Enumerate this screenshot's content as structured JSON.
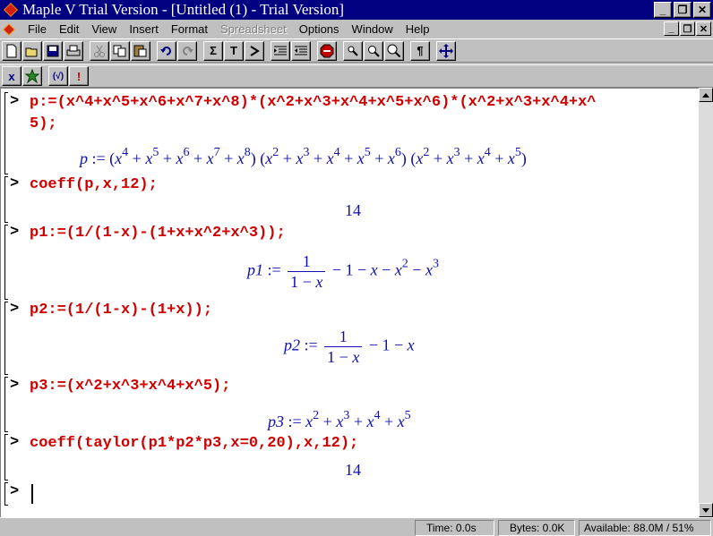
{
  "window": {
    "title": "Maple V Trial Version - [Untitled (1) - Trial Version]",
    "minimize_label": "_",
    "restore_label": "❐",
    "close_label": "✕"
  },
  "menubar": {
    "items": [
      "File",
      "Edit",
      "View",
      "Insert",
      "Format",
      "Spreadsheet",
      "Options",
      "Window",
      "Help"
    ],
    "disabled": [
      "Spreadsheet"
    ],
    "doc_minimize_label": "_",
    "doc_restore_label": "❐",
    "doc_close_label": "✕"
  },
  "toolbar": {
    "icons": [
      "new-icon",
      "open-icon",
      "save-icon",
      "print-icon",
      "cut-icon",
      "copy-icon",
      "paste-icon",
      "undo-icon",
      "redo-icon",
      "sigma-icon",
      "text-icon",
      "input-icon",
      "indent-icon",
      "outdent-icon",
      "stop-icon",
      "zoom-small-icon",
      "zoom-medium-icon",
      "zoom-large-icon",
      "paragraph-icon",
      "move-icon"
    ],
    "sigma_label": "Σ",
    "text_label": "T",
    "paragraph_label": "¶"
  },
  "toolbar2": {
    "x_label": "x",
    "exec_label": "!",
    "eval_label": "(√)"
  },
  "worksheet": {
    "prompt": ">",
    "groups": [
      {
        "input_line1": "p:=(x^4+x^5+x^6+x^7+x^8)*(x^2+x^3+x^4+x^5+x^6)*(x^2+x^3+x^4+x^",
        "input_line2": "5);"
      },
      {
        "input": "coeff(p,x,12);",
        "output": "14"
      },
      {
        "input": "p1:=(1/(1-x)-(1+x+x^2+x^3));"
      },
      {
        "input": "p2:=(1/(1-x)-(1+x));"
      },
      {
        "input": "p3:=(x^2+x^3+x^4+x^5);"
      },
      {
        "input": "coeff(taylor(p1*p2*p3,x=0,20),x,12);",
        "output": "14"
      }
    ]
  },
  "status": {
    "time": "Time:  0.0s",
    "bytes": "Bytes:  0.0K",
    "available": "Available: 88.0M / 51%"
  }
}
